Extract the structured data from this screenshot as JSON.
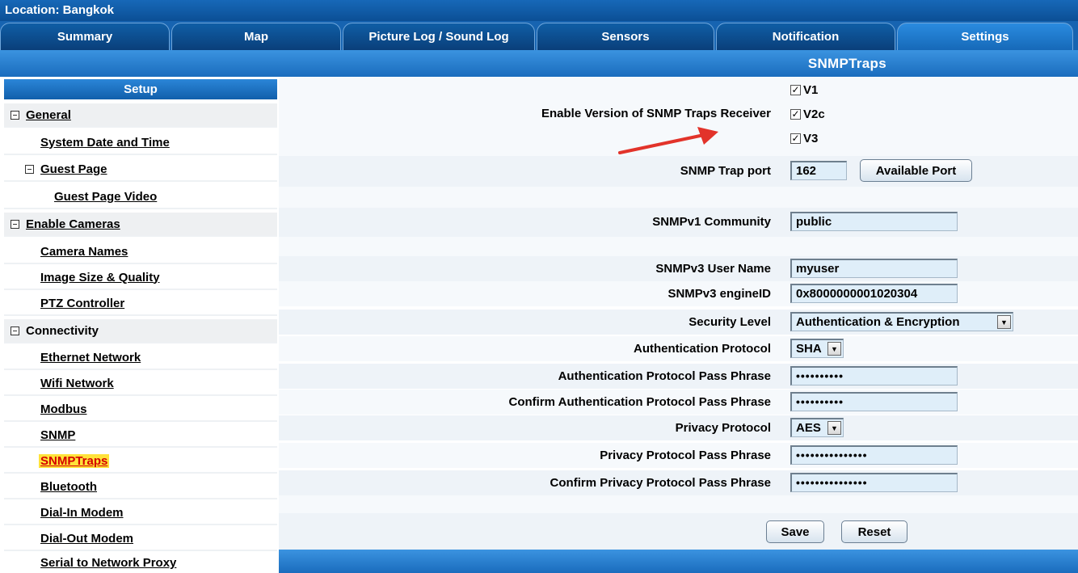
{
  "location": "Location: Bangkok",
  "tabs": [
    "Summary",
    "Map",
    "Picture Log / Sound Log",
    "Sensors",
    "Notification",
    "Settings"
  ],
  "header_title": "SNMPTraps",
  "sidebar": {
    "title": "Setup",
    "items": [
      "General",
      "System Date and Time",
      "Guest Page",
      "Guest Page Video",
      "Enable Cameras",
      "Camera Names",
      "Image Size & Quality",
      "PTZ Controller",
      "Connectivity",
      "Ethernet Network",
      "Wifi Network",
      "Modbus",
      "SNMP",
      "SNMPTraps",
      "Bluetooth",
      "Dial-In Modem",
      "Dial-Out Modem",
      "Serial to Network Proxy"
    ]
  },
  "form": {
    "versions_label": "Enable Version of SNMP Traps Receiver",
    "versions": [
      "V1",
      "V2c",
      "V3"
    ],
    "trap_port_label": "SNMP Trap port",
    "trap_port_value": "162",
    "available_port_button": "Available Port",
    "v1_community_label": "SNMPv1 Community",
    "v1_community_value": "public",
    "v3_user_label": "SNMPv3 User Name",
    "v3_user_value": "myuser",
    "engine_id_label": "SNMPv3 engineID",
    "engine_id_value": "0x8000000001020304",
    "security_level_label": "Security Level",
    "security_level_value": "Authentication & Encryption",
    "auth_protocol_label": "Authentication Protocol",
    "auth_protocol_value": "SHA",
    "auth_pass_label": "Authentication Protocol Pass Phrase",
    "auth_pass_value": "••••••••••",
    "confirm_auth_pass_label": "Confirm Authentication Protocol Pass Phrase",
    "confirm_auth_pass_value": "••••••••••",
    "privacy_protocol_label": "Privacy Protocol",
    "privacy_protocol_value": "AES",
    "privacy_pass_label": "Privacy Protocol Pass Phrase",
    "privacy_pass_value": "•••••••••••••••",
    "confirm_privacy_pass_label": "Confirm Privacy Protocol Pass Phrase",
    "confirm_privacy_pass_value": "•••••••••••••••",
    "save_button": "Save",
    "reset_button": "Reset"
  },
  "colors": {
    "header_blue": "#1a6cbd",
    "highlight": "#ffe23a",
    "arrow": "#e2332a"
  }
}
